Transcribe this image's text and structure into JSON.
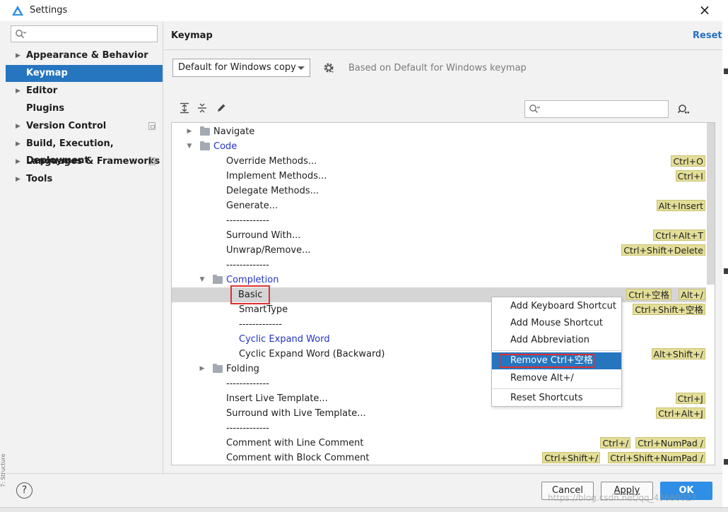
{
  "window": {
    "title": "Settings",
    "close_icon": "×",
    "side_label": "7: Structure"
  },
  "sidebar": {
    "search_placeholder": "",
    "items": [
      {
        "label": "Appearance & Behavior",
        "expandable": true
      },
      {
        "label": "Keymap",
        "selected": true
      },
      {
        "label": "Editor",
        "expandable": true
      },
      {
        "label": "Plugins"
      },
      {
        "label": "Version Control",
        "expandable": true,
        "project_icon": true
      },
      {
        "label": "Build, Execution, Deployment",
        "expandable": true
      },
      {
        "label": "Languages & Frameworks",
        "expandable": true,
        "project_icon": true
      },
      {
        "label": "Tools",
        "expandable": true
      }
    ]
  },
  "header": {
    "title": "Keymap",
    "reset_label": "Reset"
  },
  "keymap": {
    "selected": "Default for Windows copy",
    "based_on": "Based on Default for Windows keymap"
  },
  "toolbar": {
    "expand_all": "expand-all-icon",
    "collapse_all": "collapse-all-icon",
    "edit": "pencil-icon",
    "search_placeholder": ""
  },
  "tree": {
    "rows": [
      {
        "label": "Navigate",
        "folder": true,
        "toggle": "▶",
        "shortcuts": []
      },
      {
        "label": "Code",
        "folder": true,
        "toggle": "▼",
        "blue": true,
        "shortcuts": []
      },
      {
        "label": "Override Methods...",
        "shortcuts": [
          "Ctrl+O"
        ]
      },
      {
        "label": "Implement Methods...",
        "shortcuts": [
          "Ctrl+I"
        ]
      },
      {
        "label": "Delegate Methods...",
        "shortcuts": []
      },
      {
        "label": "Generate...",
        "shortcuts": [
          "Alt+Insert"
        ]
      },
      {
        "label": "-------------",
        "shortcuts": []
      },
      {
        "label": "Surround With...",
        "shortcuts": [
          "Ctrl+Alt+T"
        ]
      },
      {
        "label": "Unwrap/Remove...",
        "shortcuts": [
          "Ctrl+Shift+Delete"
        ]
      },
      {
        "label": "-------------",
        "shortcuts": []
      },
      {
        "label": "Completion",
        "folder": true,
        "toggle": "▼",
        "blue": true,
        "shortcuts": []
      },
      {
        "label": "Basic",
        "selected": true,
        "highlighted": true,
        "shortcuts": [
          "Ctrl+空格",
          "Alt+/"
        ]
      },
      {
        "label": "SmartType",
        "shortcuts": [
          "Ctrl+Shift+空格"
        ]
      },
      {
        "label": "-------------",
        "shortcuts": []
      },
      {
        "label": "Cyclic Expand Word",
        "blue": true,
        "shortcuts": []
      },
      {
        "label": "Cyclic Expand Word (Backward)",
        "shortcuts": [
          "Alt+Shift+/"
        ]
      },
      {
        "label": "Folding",
        "folder": true,
        "toggle": "▶",
        "shortcuts": []
      },
      {
        "label": "-------------",
        "shortcuts": []
      },
      {
        "label": "Insert Live Template...",
        "shortcuts": [
          "Ctrl+J"
        ]
      },
      {
        "label": "Surround with Live Template...",
        "shortcuts": [
          "Ctrl+Alt+J"
        ]
      },
      {
        "label": "-------------",
        "shortcuts": []
      },
      {
        "label": "Comment with Line Comment",
        "shortcuts": [
          "Ctrl+/",
          "Ctrl+NumPad /"
        ]
      },
      {
        "label": "Comment with Block Comment",
        "shortcuts": [
          "Ctrl+Shift+/",
          "Ctrl+Shift+NumPad /"
        ]
      }
    ]
  },
  "context_menu": {
    "items": [
      {
        "label": "Add Keyboard Shortcut"
      },
      {
        "label": "Add Mouse Shortcut"
      },
      {
        "label": "Add Abbreviation"
      },
      {
        "label": "Remove Ctrl+空格",
        "active": true
      },
      {
        "label": "Remove Alt+/"
      },
      {
        "label": "Reset Shortcuts"
      }
    ]
  },
  "footer": {
    "help_label": "?",
    "cancel_label": "Cancel",
    "apply_label": "Apply",
    "ok_label": "OK"
  },
  "watermark": "https://blog.csdn.net/qq_43680027",
  "colors": {
    "accent": "#2675bf",
    "primary_button": "#2f8fe6",
    "shortcut_bg": "#e3de98",
    "highlight_box": "#e03030",
    "link_blue": "#2470c2"
  }
}
